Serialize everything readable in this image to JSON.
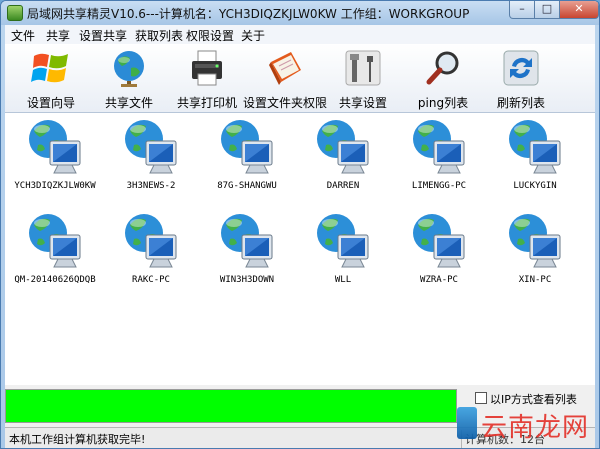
{
  "window": {
    "title": "局域网共享精灵V10.6---计算机名：YCH3DIQZKJLW0KW  工作组：WORKGROUP"
  },
  "menu": [
    "文件",
    "共享",
    "设置共享",
    "获取列表",
    "权限设置",
    "关于"
  ],
  "toolbar": [
    {
      "label": "设置向导",
      "icon": "windows-logo-icon"
    },
    {
      "label": "共享文件",
      "icon": "globe-icon"
    },
    {
      "label": "共享打印机",
      "icon": "printer-icon"
    },
    {
      "label": "设置文件夹权限",
      "icon": "folder-book-icon"
    },
    {
      "label": "共享设置",
      "icon": "tools-icon"
    },
    {
      "label": "ping列表",
      "icon": "magnifier-icon"
    },
    {
      "label": "刷新列表",
      "icon": "refresh-icon"
    }
  ],
  "computers": [
    "YCH3DIQZKJLW0KW",
    "3H3NEWS-2",
    "87G-SHANGWU",
    "DARREN",
    "LIMENGG-PC",
    "LUCKYGIN",
    "QM-20140626QDQB",
    "RAKC-PC",
    "WIN3H3DOWN",
    "WLL",
    "WZRA-PC",
    "XIN-PC"
  ],
  "progress": {
    "percent": 100,
    "color": "#00ff00"
  },
  "options": {
    "ip_view_label": "以IP方式查看列表"
  },
  "status": {
    "message": "本机工作组计算机获取完毕!",
    "count": "计算机数：12台"
  },
  "watermark": {
    "text": "云南龙网"
  }
}
